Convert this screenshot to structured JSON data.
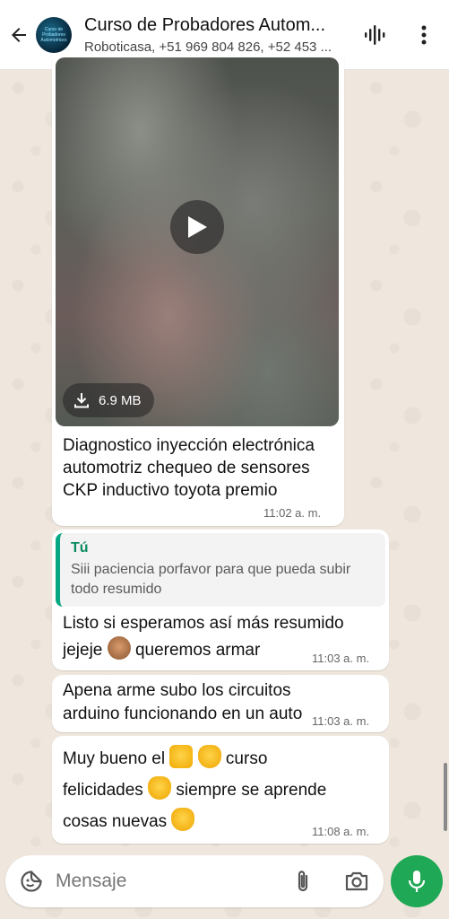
{
  "header": {
    "title": "Curso de Probadores Autom...",
    "subtitle": "Roboticasa, +51 969 804 826, +52 453 ...",
    "avatar_text": "Curso de Probadores Automotrices"
  },
  "icons": {
    "back": "arrow-left-icon",
    "voice_call": "audio-wave-icon",
    "menu": "more-vertical-icon",
    "play": "play-icon",
    "download": "download-icon",
    "emoji": "sticker-icon",
    "attach": "paperclip-icon",
    "camera": "camera-icon",
    "mic": "microphone-icon"
  },
  "colors": {
    "accent_green": "#1fa855",
    "quote_bar": "#06a884",
    "quote_author": "#0b8a5f"
  },
  "messages": {
    "video": {
      "size": "6.9 MB",
      "caption": "Diagnostico inyección electrónica automotriz chequeo de sensores CKP inductivo toyota premio",
      "time": "11:02 a. m."
    },
    "reply": {
      "quote_author": "Tú",
      "quote_text": "Siii paciencia porfavor para que pueda subir todo resumido",
      "text_line1": "Listo si esperamos así más resumido",
      "text_part2a": "jejeje",
      "text_part2b": "queremos armar",
      "time": "11:03 a. m."
    },
    "circuits": {
      "text": "Apena arme subo los circuitos arduino funcionando en un auto",
      "time": "11:03 a. m."
    },
    "congrats": {
      "line1a": "Muy bueno el",
      "line1b": "curso",
      "line2a": "felicidades",
      "line2b": "siempre se aprende",
      "line3": "cosas nuevas",
      "time": "11:08 a. m."
    }
  },
  "input": {
    "placeholder": "Mensaje"
  }
}
